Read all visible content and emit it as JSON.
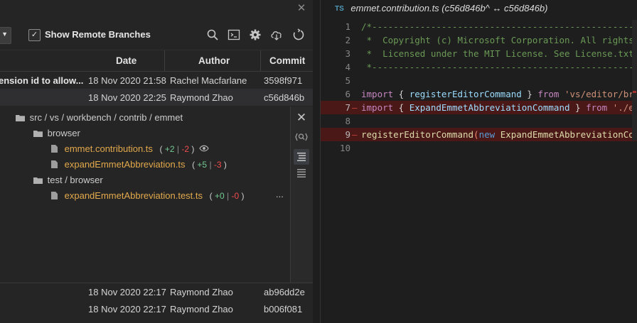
{
  "toolbar": {
    "show_remote_label": "Show Remote Branches",
    "show_remote_checked": true,
    "icons": [
      "search-icon",
      "terminal-icon",
      "gear-icon",
      "cloud-download-icon",
      "refresh-icon"
    ]
  },
  "table": {
    "headers": [
      "Date",
      "Author",
      "Commit"
    ],
    "rows": [
      {
        "description": "ension id to allow...",
        "date": "18 Nov 2020 21:58",
        "author": "Rachel Macfarlane",
        "commit": "3598f971"
      },
      {
        "description": "",
        "date": "18 Nov 2020 22:25",
        "author": "Raymond Zhao",
        "commit": "c56d846b"
      },
      {
        "description": "",
        "date": "18 Nov 2020 22:17",
        "author": "Raymond Zhao",
        "commit": "ab96dd2e"
      },
      {
        "description": "",
        "date": "18 Nov 2020 22:17",
        "author": "Raymond Zhao",
        "commit": "b006f081"
      }
    ]
  },
  "details": {
    "path": [
      "src",
      "vs",
      "workbench",
      "contrib",
      "emmet"
    ],
    "path_sep": "/",
    "folders": [
      {
        "name": "browser",
        "files": [
          {
            "name": "emmet.contribution.ts",
            "add": "+2",
            "del": "-2",
            "viewed": true
          },
          {
            "name": "expandEmmetAbbreviation.ts",
            "add": "+5",
            "del": "-3"
          }
        ]
      },
      {
        "name": "test / browser",
        "files": [
          {
            "name": "expandEmmetAbbreviation.test.ts",
            "add": "+0",
            "del": "-0",
            "more": "..."
          }
        ]
      }
    ]
  },
  "editor": {
    "tab_lang": "TS",
    "tab_title": "emmet.contribution.ts (c56d846b^ ↔ c56d846b)",
    "lines": [
      {
        "n": "1",
        "text": "/*-------------------------------------------------------------"
      },
      {
        "n": "2",
        "text": " *  Copyright (c) Microsoft Corporation. All rights reserved."
      },
      {
        "n": "3",
        "text": " *  Licensed under the MIT License. See License.txt in the project root"
      },
      {
        "n": "4",
        "text": " *-------------------------------------------------------------"
      },
      {
        "n": "5",
        "text": ""
      },
      {
        "n": "6",
        "text": "import { registerEditorCommand } from 'vs/editor/browser/editorExtensions';"
      },
      {
        "n": "7",
        "text": "import { ExpandEmmetAbbreviationCommand } from './expandEmmetAbbreviation';"
      },
      {
        "n": "8",
        "text": ""
      },
      {
        "n": "9",
        "text": "registerEditorCommand(new ExpandEmmetAbbreviationCommand());"
      },
      {
        "n": "10",
        "text": ""
      }
    ],
    "deleted_marker": "—"
  },
  "colors": {
    "accent": "#519aba",
    "deleted_line": "#4b1818",
    "added": "#73c991",
    "removed": "#f14c4c",
    "file_modified": "#e2a94b"
  }
}
